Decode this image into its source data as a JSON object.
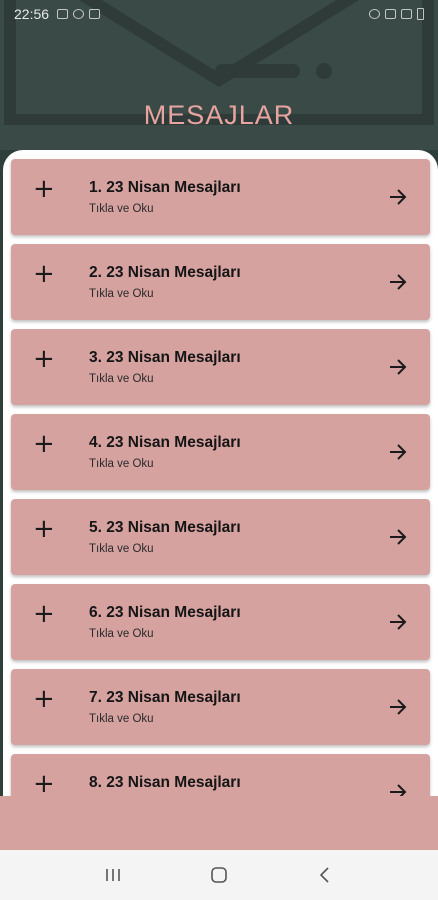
{
  "status_bar": {
    "time": "22:56"
  },
  "header": {
    "title": "MESAJLAR"
  },
  "messages": [
    {
      "title": "1. 23 Nisan Mesajları",
      "subtitle": "Tıkla ve Oku"
    },
    {
      "title": "2. 23 Nisan Mesajları",
      "subtitle": "Tıkla ve Oku"
    },
    {
      "title": "3. 23 Nisan Mesajları",
      "subtitle": "Tıkla ve Oku"
    },
    {
      "title": "4. 23 Nisan Mesajları",
      "subtitle": "Tıkla ve Oku"
    },
    {
      "title": "5. 23 Nisan Mesajları",
      "subtitle": "Tıkla ve Oku"
    },
    {
      "title": "6. 23 Nisan Mesajları",
      "subtitle": "Tıkla ve Oku"
    },
    {
      "title": "7. 23 Nisan Mesajları",
      "subtitle": "Tıkla ve Oku"
    },
    {
      "title": "8. 23 Nisan Mesajları",
      "subtitle": ""
    }
  ],
  "colors": {
    "card": "#d5a2a0",
    "title": "#e7a4a0",
    "header_bg": "#3a4a46"
  },
  "icons": {
    "card_leading": "plus-icon",
    "card_trailing": "arrow-right-icon",
    "nav": [
      "recents-icon",
      "home-icon",
      "back-icon"
    ]
  }
}
